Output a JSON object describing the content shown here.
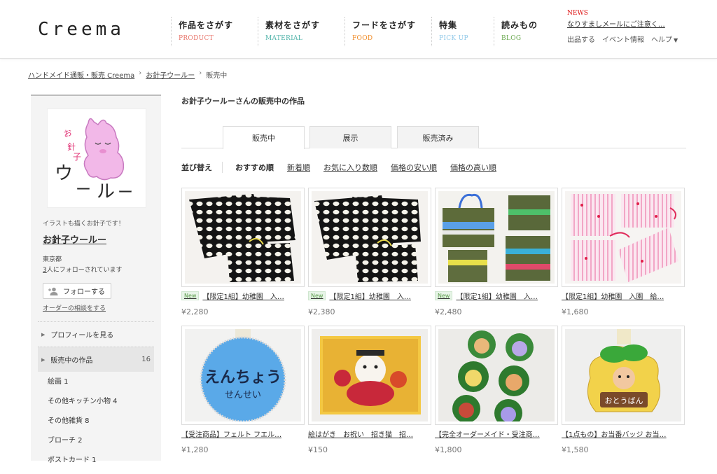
{
  "header": {
    "logo": "Creema",
    "nav": [
      {
        "jp": "作品をさがす",
        "en": "PRODUCT",
        "color": "#e8746a"
      },
      {
        "jp": "素材をさがす",
        "en": "MATERIAL",
        "color": "#4fb3a9"
      },
      {
        "jp": "フードをさがす",
        "en": "FOOD",
        "color": "#f08a24"
      },
      {
        "jp": "特集",
        "en": "PICK UP",
        "color": "#8fc8e8"
      },
      {
        "jp": "読みもの",
        "en": "BLOG",
        "color": "#6aa84f"
      }
    ],
    "news_label": "NEWS",
    "news_text": "なりすましメールにご注意く…",
    "sublinks": [
      "出品する",
      "イベント情報",
      "ヘルプ"
    ]
  },
  "breadcrumb": [
    "ハンドメイド通販・販売 Creema",
    "お針子ウールー",
    "販売中"
  ],
  "sidebar": {
    "tagline": "イラストも描くお針子です！",
    "shop_name": "お針子ウールー",
    "location": "東京都",
    "followers_count": "3",
    "followers_suffix": "人にフォローされています",
    "follow_button": "フォローする",
    "order_link": "オーダーの相談をする",
    "menu": [
      {
        "label": "プロフィールを見る",
        "count": ""
      },
      {
        "label": "販売中の作品",
        "count": "16"
      }
    ],
    "subcategories": [
      "絵画  1",
      "その他キッチン小物  4",
      "その他雑貨  8",
      "ブローチ  2",
      "ポストカード  1"
    ]
  },
  "main": {
    "title": "お針子ウールーさんの販売中の作品",
    "tabs": [
      "販売中",
      "展示",
      "販売済み"
    ],
    "sort_label": "並び替え",
    "sort_options": [
      "おすすめ順",
      "新着順",
      "お気に入り数順",
      "価格の安い順",
      "価格の高い順"
    ],
    "products": [
      {
        "badge": "New",
        "name": "【限定1組】幼稚園　入…",
        "price": "¥2,280"
      },
      {
        "badge": "New",
        "name": "【限定1組】幼稚園　入…",
        "price": "¥2,380"
      },
      {
        "badge": "New",
        "name": "【限定1組】幼稚園　入…",
        "price": "¥2,480"
      },
      {
        "badge": "",
        "name": "【限定1組】幼稚園　入園　給…",
        "price": "¥1,680"
      },
      {
        "badge": "",
        "name": "【受注商品】フェルト フエル…",
        "price": "¥1,280"
      },
      {
        "badge": "",
        "name": "絵はがき　お祝い　招き猫　招…",
        "price": "¥150"
      },
      {
        "badge": "",
        "name": "【完全オーダーメイド・受注商…",
        "price": "¥1,800"
      },
      {
        "badge": "",
        "name": "【1点もの】お当番バッジ お当…",
        "price": "¥1,580"
      }
    ],
    "badge_text_5": "えんちょう",
    "badge_text_5b": "せんせい",
    "badge_text_8": "おとうばん"
  }
}
